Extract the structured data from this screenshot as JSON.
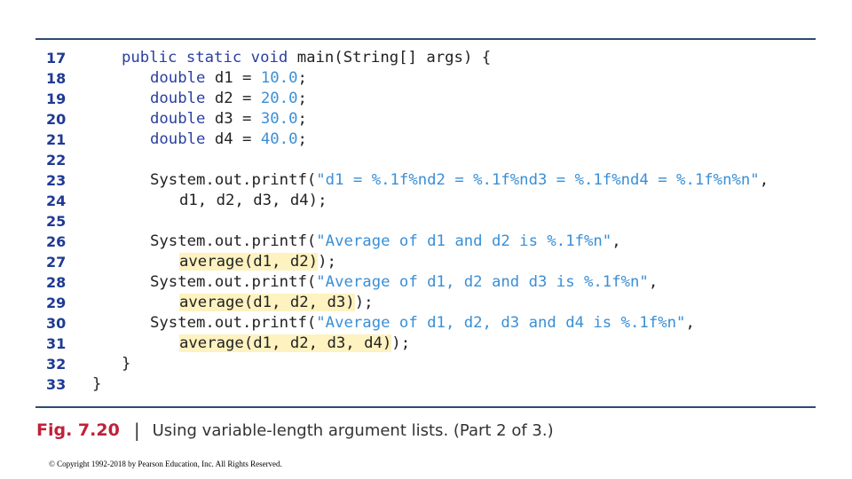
{
  "code": {
    "lines": [
      {
        "number": "17",
        "indent": 1,
        "tokens": [
          {
            "t": "public static void ",
            "c": "kw"
          },
          {
            "t": "main(String[] args) {",
            "c": "plain"
          }
        ]
      },
      {
        "number": "18",
        "indent": 2,
        "tokens": [
          {
            "t": "double ",
            "c": "kw"
          },
          {
            "t": "d1 = ",
            "c": "plain"
          },
          {
            "t": "10.0",
            "c": "num"
          },
          {
            "t": ";",
            "c": "plain"
          }
        ]
      },
      {
        "number": "19",
        "indent": 2,
        "tokens": [
          {
            "t": "double ",
            "c": "kw"
          },
          {
            "t": "d2 = ",
            "c": "plain"
          },
          {
            "t": "20.0",
            "c": "num"
          },
          {
            "t": ";",
            "c": "plain"
          }
        ]
      },
      {
        "number": "20",
        "indent": 2,
        "tokens": [
          {
            "t": "double ",
            "c": "kw"
          },
          {
            "t": "d3 = ",
            "c": "plain"
          },
          {
            "t": "30.0",
            "c": "num"
          },
          {
            "t": ";",
            "c": "plain"
          }
        ]
      },
      {
        "number": "21",
        "indent": 2,
        "tokens": [
          {
            "t": "double ",
            "c": "kw"
          },
          {
            "t": "d4 = ",
            "c": "plain"
          },
          {
            "t": "40.0",
            "c": "num"
          },
          {
            "t": ";",
            "c": "plain"
          }
        ]
      },
      {
        "number": "22",
        "indent": 0,
        "tokens": []
      },
      {
        "number": "23",
        "indent": 2,
        "tokens": [
          {
            "t": "System.out.printf(",
            "c": "plain"
          },
          {
            "t": "\"d1 = %.1f%nd2 = %.1f%nd3 = %.1f%nd4 = %.1f%n%n\"",
            "c": "str"
          },
          {
            "t": ",",
            "c": "plain"
          }
        ]
      },
      {
        "number": "24",
        "indent": 3,
        "tokens": [
          {
            "t": "d1, d2, d3, d4);",
            "c": "plain"
          }
        ]
      },
      {
        "number": "25",
        "indent": 0,
        "tokens": []
      },
      {
        "number": "26",
        "indent": 2,
        "tokens": [
          {
            "t": "System.out.printf(",
            "c": "plain"
          },
          {
            "t": "\"Average of d1 and d2 is %.1f%n\"",
            "c": "str"
          },
          {
            "t": ",",
            "c": "plain"
          }
        ]
      },
      {
        "number": "27",
        "indent": 3,
        "tokens": [
          {
            "t": "average(d1, d2)",
            "c": "hl"
          },
          {
            "t": ");",
            "c": "plain"
          }
        ]
      },
      {
        "number": "28",
        "indent": 2,
        "tokens": [
          {
            "t": "System.out.printf(",
            "c": "plain"
          },
          {
            "t": "\"Average of d1, d2 and d3 is %.1f%n\"",
            "c": "str"
          },
          {
            "t": ",",
            "c": "plain"
          }
        ]
      },
      {
        "number": "29",
        "indent": 3,
        "tokens": [
          {
            "t": "average(d1, d2, d3)",
            "c": "hl"
          },
          {
            "t": ");",
            "c": "plain"
          }
        ]
      },
      {
        "number": "30",
        "indent": 2,
        "tokens": [
          {
            "t": "System.out.printf(",
            "c": "plain"
          },
          {
            "t": "\"Average of d1, d2, d3 and d4 is %.1f%n\"",
            "c": "str"
          },
          {
            "t": ",",
            "c": "plain"
          }
        ]
      },
      {
        "number": "31",
        "indent": 3,
        "tokens": [
          {
            "t": "average(d1, d2, d3, d4)",
            "c": "hl"
          },
          {
            "t": ");",
            "c": "plain"
          }
        ]
      },
      {
        "number": "32",
        "indent": 1,
        "tokens": [
          {
            "t": "}",
            "c": "plain"
          }
        ]
      },
      {
        "number": "33",
        "indent": 0,
        "tokens": [
          {
            "t": "}",
            "c": "plain"
          }
        ]
      }
    ]
  },
  "caption": {
    "label": "Fig. 7.20",
    "separator": "|",
    "text": "Using variable-length argument lists. (Part 2 of 3.)"
  },
  "copyright": "© Copyright 1992-2018 by Pearson Education, Inc. All Rights Reserved.",
  "colors": {
    "line_number": "#1f3a93",
    "keyword": "#2a3fa0",
    "literal": "#3a8fd6",
    "highlight": "#fdf2c0",
    "fig_label": "#c0203a",
    "rule": "#2e4a6e"
  }
}
